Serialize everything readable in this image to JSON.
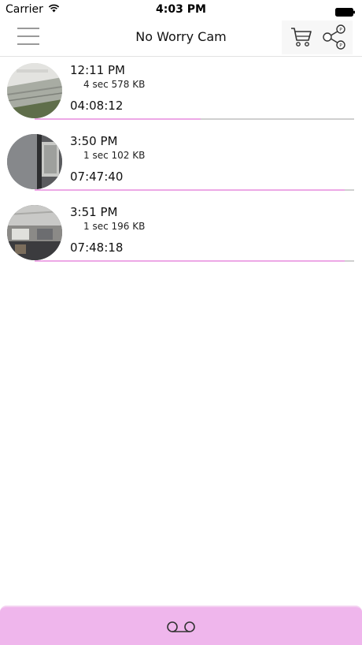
{
  "status_bar": {
    "carrier": "Carrier",
    "time": "4:03 PM"
  },
  "nav": {
    "title": "No Worry Cam",
    "icons": [
      "menu-icon",
      "cart-icon",
      "share-icon"
    ]
  },
  "recordings": [
    {
      "time": "12:11 PM",
      "meta": "4 sec 578 KB",
      "duration": "04:08:12",
      "progress": 0.52
    },
    {
      "time": "3:50 PM",
      "meta": "1 sec 102 KB",
      "duration": "07:47:40",
      "progress": 0.97
    },
    {
      "time": "3:51 PM",
      "meta": "1 sec 196 KB",
      "duration": "07:48:18",
      "progress": 0.97
    }
  ],
  "bottom_bar": {
    "icon": "voicemail-icon"
  },
  "colors": {
    "accent_pink": "#efb6ec",
    "progress_fill": "#eda8e6",
    "progress_track": "#cfcfcf"
  }
}
